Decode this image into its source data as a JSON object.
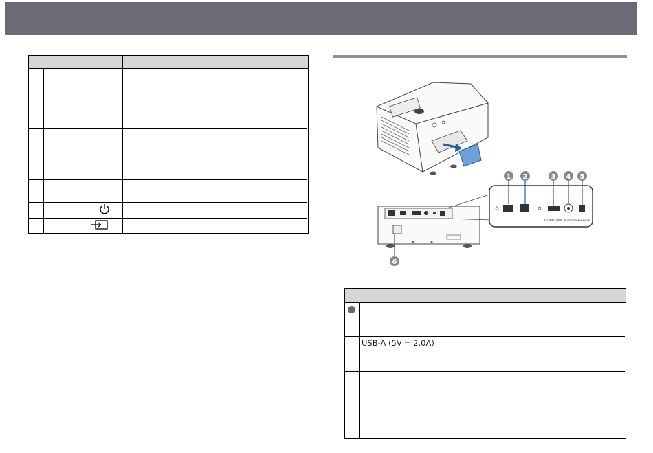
{
  "ports_table": {
    "rows": [
      {
        "number": "",
        "name": "USB-A (5V ⎓ 2.0A)"
      }
    ]
  },
  "icons": {
    "power": "power-icon",
    "source": "source-icon",
    "port_number_1": "number-1-circle-icon"
  },
  "colors": {
    "header_bar": "#6b6b78",
    "table_header": "#d6d6d6",
    "cover_blue": "#6fa0d8"
  }
}
